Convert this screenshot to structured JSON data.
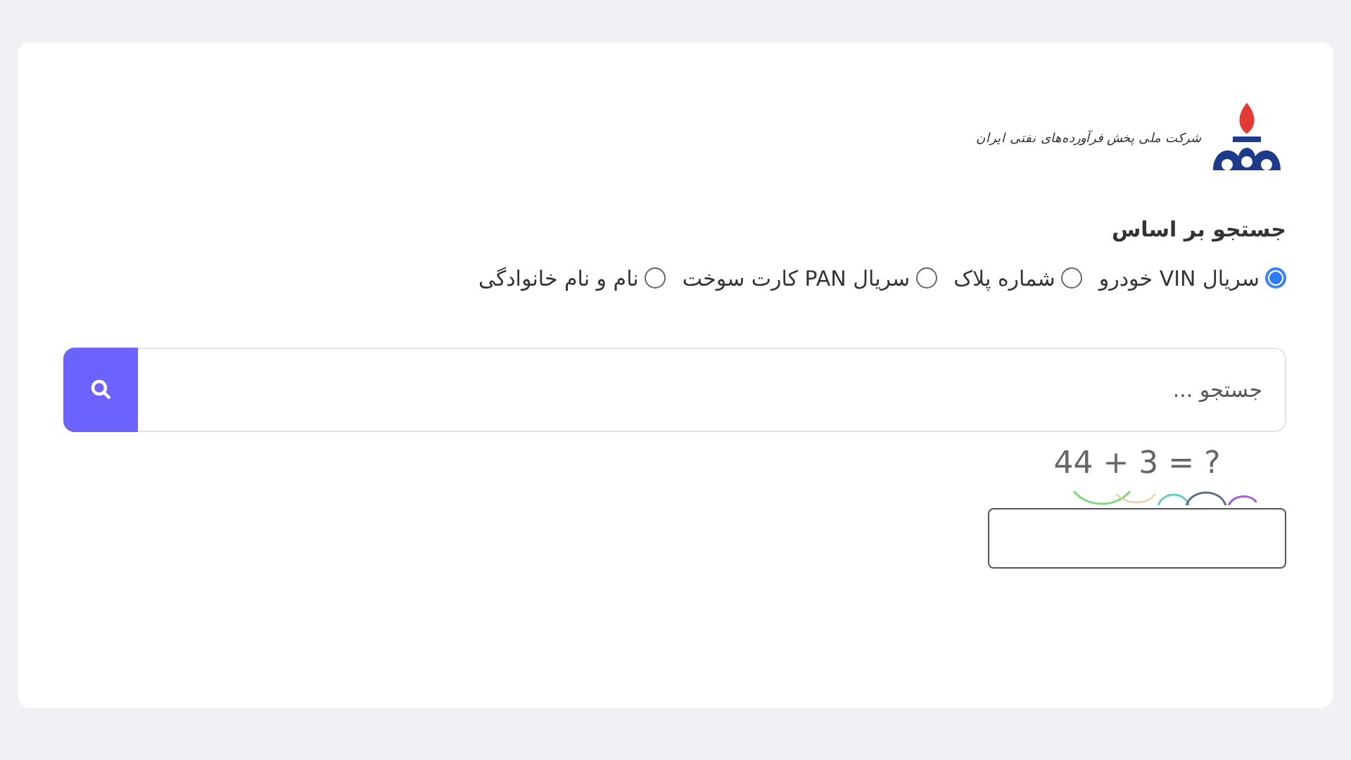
{
  "logo": {
    "text": "شرکت ملی پخش فرآورده‌های نفتی ایران"
  },
  "search_by": {
    "label": "جستجو بر اساس",
    "options": [
      {
        "label": "سریال VIN خودرو",
        "selected": true
      },
      {
        "label": "شماره پلاک",
        "selected": false
      },
      {
        "label": "سریال PAN کارت سوخت",
        "selected": false
      },
      {
        "label": "نام و نام خانوادگی",
        "selected": false
      }
    ]
  },
  "search": {
    "placeholder": "جستجو ..."
  },
  "captcha": {
    "text": "44 + 3 = ?"
  }
}
